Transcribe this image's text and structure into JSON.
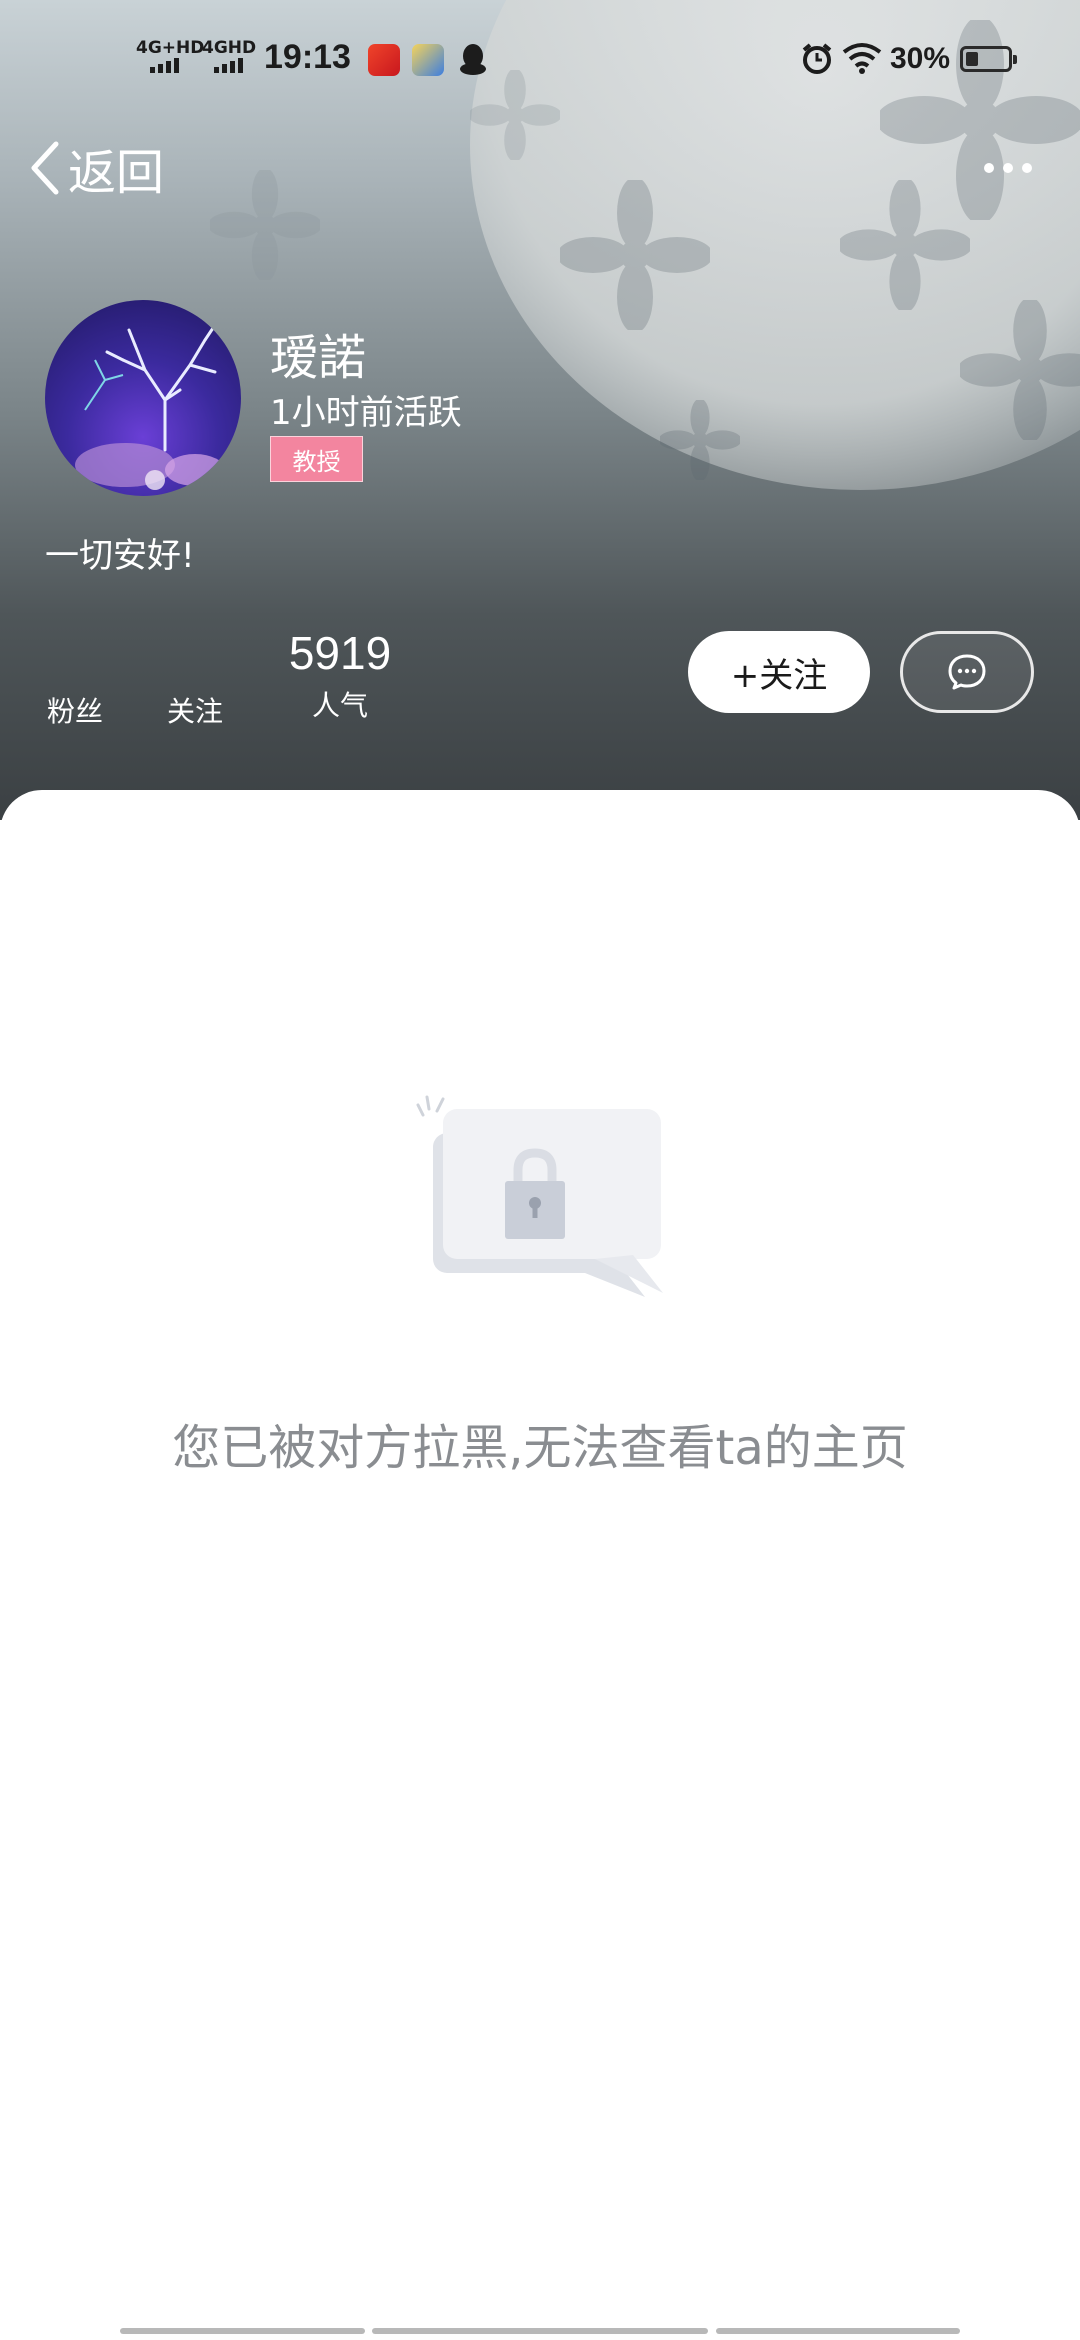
{
  "status_bar": {
    "network_1": "4G+HD",
    "network_2": "4GHD",
    "time": "19:13",
    "battery_percent": "30%",
    "battery_level": 0.3
  },
  "header": {
    "back_label": "返回"
  },
  "profile": {
    "username": "瑷諾",
    "active_status": "1小时前活跃",
    "rank_badge": "教授",
    "bio": "一切安好!",
    "stats": {
      "fans_label": "粉丝",
      "following_label": "关注",
      "popularity_value": "5919",
      "popularity_label": "人气"
    },
    "follow_button": "+关注"
  },
  "content": {
    "blocked_message": "您已被对方拉黑,无法查看ta的主页"
  },
  "colors": {
    "badge": "#f3859f",
    "message_text": "#8a8d91"
  }
}
